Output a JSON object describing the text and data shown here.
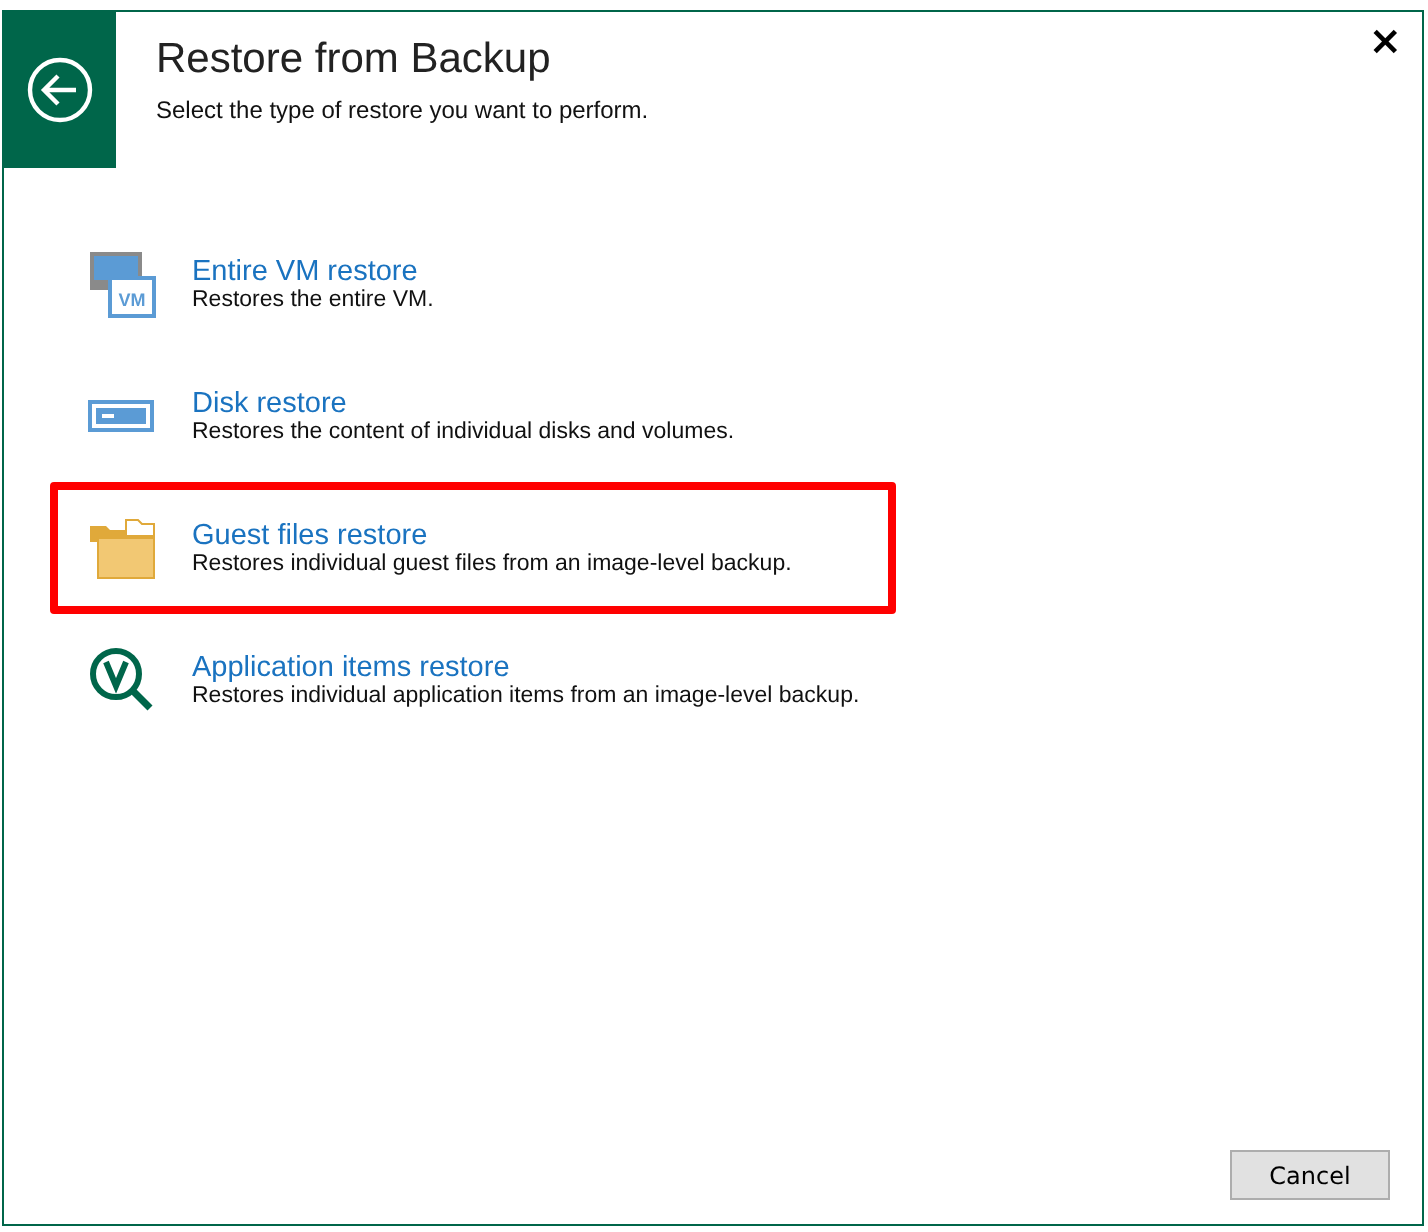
{
  "dialog": {
    "title": "Restore from Backup",
    "subtitle": "Select the type of restore you want to perform.",
    "close": "×"
  },
  "options": [
    {
      "kind": "vm",
      "icon_text": "VM",
      "title": "Entire VM restore",
      "description": "Restores the entire VM.",
      "highlighted": false
    },
    {
      "kind": "disk",
      "title": "Disk restore",
      "description": "Restores the content of individual disks and volumes.",
      "highlighted": false
    },
    {
      "kind": "files",
      "title": "Guest files restore",
      "description": "Restores individual guest files from an image-level backup.",
      "highlighted": true
    },
    {
      "kind": "app",
      "title": "Application items restore",
      "description": "Restores individual application items from an image-level backup.",
      "highlighted": false
    }
  ],
  "buttons": [
    "Cancel"
  ]
}
